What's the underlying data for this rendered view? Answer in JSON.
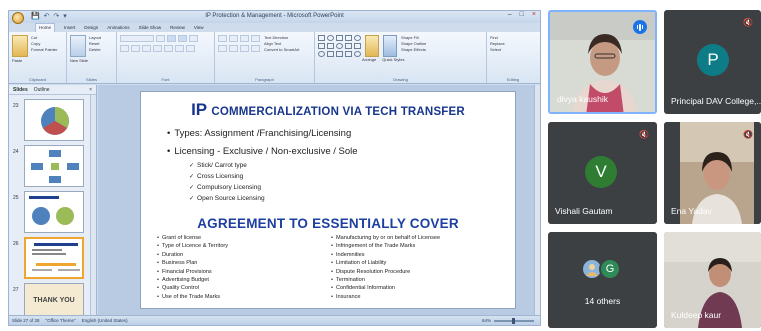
{
  "window": {
    "title": "IP Protection & Management - Microsoft PowerPoint",
    "controls": [
      "–",
      "□",
      "×"
    ]
  },
  "ribbon": {
    "tabs": [
      "Home",
      "Insert",
      "Design",
      "Animations",
      "Slide Show",
      "Review",
      "View"
    ],
    "active_tab": "Home",
    "groups": [
      "Clipboard",
      "Slides",
      "Font",
      "Paragraph",
      "Drawing",
      "Editing"
    ],
    "buttons": {
      "cut": "Cut",
      "copy": "Copy",
      "format_painter": "Format Painter",
      "paste": "Paste",
      "new_slide": "New Slide",
      "layout": "Layout",
      "reset": "Reset",
      "delete": "Delete",
      "text_direction": "Text Direction",
      "align_text": "Align Text",
      "convert_smartart": "Convert to SmartArt",
      "arrange": "Arrange",
      "quick_styles": "Quick Styles",
      "shape_fill": "Shape Fill",
      "shape_outline": "Shape Outline",
      "shape_effects": "Shape Effects",
      "find": "Find",
      "replace": "Replace",
      "select": "Select"
    }
  },
  "left_pane": {
    "tabs": [
      "Slides",
      "Outline"
    ],
    "thumb_numbers": [
      "23",
      "24",
      "25",
      "26",
      "27"
    ],
    "thumb_last_text": "THANK YOU"
  },
  "slide": {
    "title_ip": "IP",
    "title_rest": "COMMERCIALIZATION VIA TECH TRANSFER",
    "bullets": [
      "Types: Assignment /Franchising/Licensing",
      "Licensing  - Exclusive / Non-exclusive / Sole"
    ],
    "sub_items": [
      "Stick/ Carrot type",
      "Cross Licensing",
      "Compulsory Licensing",
      "Open Source Licensing"
    ],
    "heading2": "AGREEMENT TO ESSENTIALLY COVER",
    "left_col": [
      "Grant of license",
      "Type of Licence & Territory",
      "Duration",
      "Business Plan",
      "Financial Provisions",
      "Advertising Budget",
      "Quality Control",
      "Use of the Trade Marks"
    ],
    "right_col": [
      "Manufacturing by or on behalf of Licensee",
      "Infringement of the Trade Marks",
      "Indemnities",
      "Limitation of Liability",
      "Dispute Resolution Procedure",
      "Termination",
      "Confidential Information",
      "Insurance"
    ]
  },
  "statusbar": {
    "slide_info": "Slide 27 of 28",
    "theme": "\"Office Theme\"",
    "language": "English (United States)",
    "zoom": "64%"
  },
  "participants": {
    "divya": {
      "name": "divya kaushik"
    },
    "principal": {
      "name": "Principal DAV College,...",
      "initial": "P"
    },
    "vishali": {
      "name": "Vishali Gautam",
      "initial": "V"
    },
    "ena": {
      "name": "Ena Yadav"
    },
    "others": {
      "label": "14 others",
      "initial": "G"
    },
    "kuldeep": {
      "name": "Kuldeep kaur"
    }
  },
  "colors": {
    "slide_title": "#18368d",
    "avatar_principal": "#0e7c86",
    "avatar_vishali": "#2e7d32",
    "avatar_g": "#2e8b57",
    "tile_bg": "#3c4043",
    "speaking": "#1a73e8"
  },
  "icons": {
    "mic_off": "microphone-off-icon",
    "speaking": "speaking-indicator-icon"
  }
}
